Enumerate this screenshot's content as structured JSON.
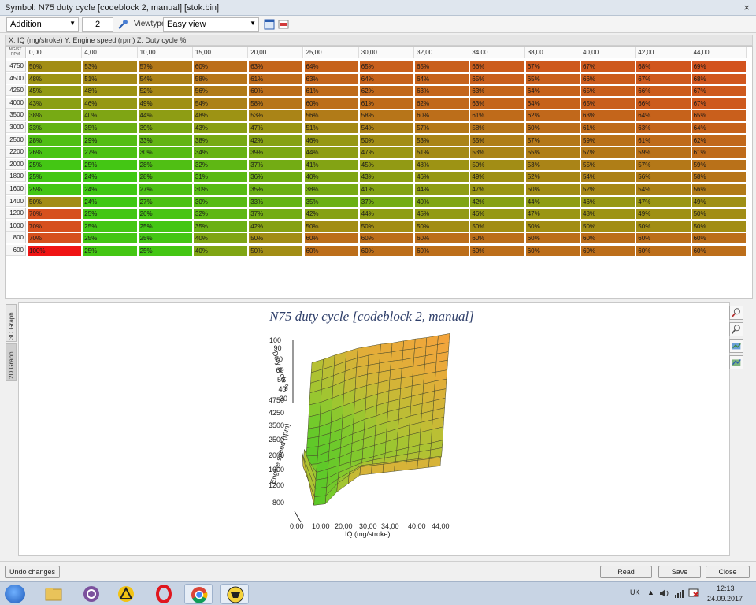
{
  "window": {
    "title": "Symbol: N75 duty cycle [codeblock 2, manual] [stok.bin]",
    "close": "×"
  },
  "toolbar": {
    "mode": "Addition",
    "amount": "2",
    "viewtype_label": "Viewtype",
    "viewtype_value": "Easy view"
  },
  "axis_info": "X: IQ (mg/stroke) Y: Engine speed (rpm) Z: Duty cycle %",
  "grid": {
    "corner_top": "MG/ST",
    "corner_bottom": "RPM",
    "cols": [
      "0,00",
      "4,00",
      "10,00",
      "15,00",
      "20,00",
      "25,00",
      "30,00",
      "32,00",
      "34,00",
      "38,00",
      "40,00",
      "42,00",
      "44,00"
    ],
    "rows": [
      "4750",
      "4500",
      "4250",
      "4000",
      "3500",
      "3000",
      "2500",
      "2200",
      "2000",
      "1800",
      "1600",
      "1400",
      "1200",
      "1000",
      "800",
      "600"
    ],
    "values": [
      [
        50,
        53,
        57,
        60,
        63,
        64,
        65,
        65,
        66,
        67,
        67,
        68,
        69
      ],
      [
        48,
        51,
        54,
        58,
        61,
        63,
        64,
        64,
        65,
        65,
        66,
        67,
        68
      ],
      [
        45,
        48,
        52,
        56,
        60,
        61,
        62,
        63,
        63,
        64,
        65,
        66,
        67
      ],
      [
        43,
        46,
        49,
        54,
        58,
        60,
        61,
        62,
        63,
        64,
        65,
        66,
        67
      ],
      [
        38,
        40,
        44,
        48,
        53,
        56,
        58,
        60,
        61,
        62,
        63,
        64,
        65
      ],
      [
        33,
        35,
        39,
        43,
        47,
        51,
        54,
        57,
        58,
        60,
        61,
        63,
        64
      ],
      [
        28,
        29,
        33,
        38,
        42,
        46,
        50,
        53,
        55,
        57,
        59,
        61,
        62
      ],
      [
        26,
        27,
        30,
        34,
        39,
        44,
        47,
        51,
        53,
        55,
        57,
        59,
        61
      ],
      [
        25,
        25,
        28,
        32,
        37,
        41,
        45,
        48,
        50,
        53,
        55,
        57,
        59
      ],
      [
        25,
        24,
        28,
        31,
        36,
        40,
        43,
        46,
        49,
        52,
        54,
        56,
        58
      ],
      [
        25,
        24,
        27,
        30,
        35,
        38,
        41,
        44,
        47,
        50,
        52,
        54,
        56
      ],
      [
        50,
        24,
        27,
        30,
        33,
        35,
        37,
        40,
        42,
        44,
        46,
        47,
        49
      ],
      [
        70,
        25,
        26,
        32,
        37,
        42,
        44,
        45,
        46,
        47,
        48,
        49,
        50
      ],
      [
        70,
        25,
        25,
        35,
        42,
        50,
        50,
        50,
        50,
        50,
        50,
        50,
        50
      ],
      [
        70,
        25,
        25,
        40,
        50,
        60,
        60,
        60,
        60,
        60,
        60,
        60,
        60
      ],
      [
        100,
        25,
        25,
        40,
        50,
        60,
        60,
        60,
        60,
        60,
        60,
        60,
        60
      ]
    ]
  },
  "graph": {
    "tab_3d": "3D Graph",
    "tab_2d": "2D Graph",
    "title": "N75 duty cycle [codeblock 2, manual]",
    "z_label": "Duty cycle %",
    "z_ticks": [
      "100",
      "90",
      "70",
      "60",
      "50",
      "40",
      "30"
    ],
    "y_label": "Engine speed (rpm)",
    "y_ticks": [
      "4750",
      "4250",
      "3500",
      "2500",
      "2000",
      "1600",
      "1200",
      "800"
    ],
    "x_label": "IQ (mg/stroke)",
    "x_ticks": [
      "0,00",
      "10,00",
      "20,00",
      "30,00",
      "34,00",
      "40,00",
      "44,00"
    ]
  },
  "buttons": {
    "undo": "Undo changes",
    "read": "Read",
    "save": "Save",
    "close": "Close"
  },
  "tray": {
    "lang": "UK",
    "time": "12:13",
    "date": "24.09.2017"
  }
}
